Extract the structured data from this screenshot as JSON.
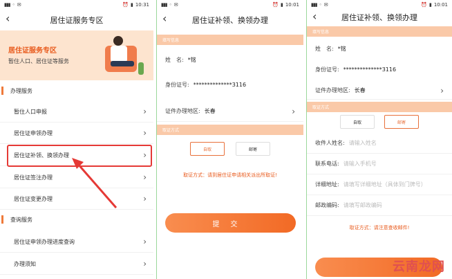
{
  "p1": {
    "time": "10:31",
    "title": "居住证服务专区",
    "banner_title": "居住证服务专区",
    "banner_sub": "暂住人口、居住证等服务",
    "sec1": "办理服务",
    "items1": [
      "暂住人口申报",
      "居住证申领办理",
      "居住证补领、换领办理",
      "居住证签注办理",
      "居住证变更办理"
    ],
    "sec2": "查询服务",
    "items2": [
      "居住证申领办理进度查询",
      "办理须知"
    ]
  },
  "p2": {
    "time": "10:01",
    "title": "居住证补领、换领办理",
    "band_info": "填写信息",
    "name_label": "姓　名:",
    "name_value": "*铭",
    "id_label": "身份证号:",
    "id_value": "**************3116",
    "area_label": "证件办理地区:",
    "area_value": "长春",
    "band_method": "取证方式",
    "opt1": "自取",
    "opt2": "邮寄",
    "note": "取证方式：请到居住证申请相关派出所取证!",
    "submit": "提交"
  },
  "p3": {
    "time": "10:01",
    "title": "居住证补领、换领办理",
    "band_info": "填写信息",
    "name_label": "姓　名:",
    "name_value": "*铭",
    "id_label": "身份证号:",
    "id_value": "**************3116",
    "area_label": "证件办理地区:",
    "area_value": "长春",
    "band_method": "取证方式",
    "opt1": "自取",
    "opt2": "邮寄",
    "recv_label": "收件人姓名:",
    "recv_ph": "请输入姓名",
    "phone_label": "联系电话:",
    "phone_ph": "请输入手机号",
    "addr_label": "详细地址:",
    "addr_ph": "请填写详细地址（具体到门牌号）",
    "zip_label": "邮政编码:",
    "zip_ph": "请填写邮政编码",
    "note": "取证方式：请注意查收邮件!"
  },
  "watermark": "云南龙网",
  "colors": {
    "accent": "#f26a25",
    "band": "#fac9a8",
    "highlight": "#e53935"
  }
}
